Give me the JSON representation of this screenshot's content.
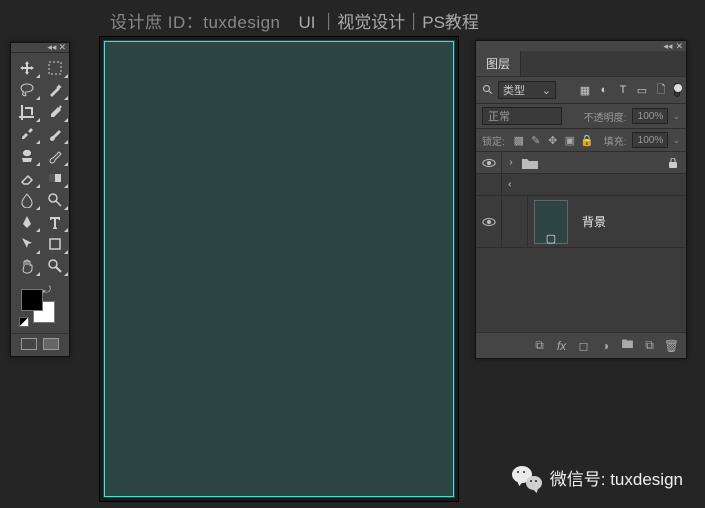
{
  "header": {
    "author_prefix": "设计庶 ID：",
    "author_id": "tuxdesign",
    "tags": "UI ｜视觉设计｜PS教程"
  },
  "tools": [
    {
      "name": "move-tool"
    },
    {
      "name": "marquee-tool"
    },
    {
      "name": "lasso-tool"
    },
    {
      "name": "magic-wand-tool"
    },
    {
      "name": "crop-tool"
    },
    {
      "name": "eyedropper-tool"
    },
    {
      "name": "healing-brush-tool"
    },
    {
      "name": "brush-tool"
    },
    {
      "name": "clone-stamp-tool"
    },
    {
      "name": "history-brush-tool"
    },
    {
      "name": "eraser-tool"
    },
    {
      "name": "gradient-tool"
    },
    {
      "name": "blur-tool"
    },
    {
      "name": "dodge-tool"
    },
    {
      "name": "pen-tool"
    },
    {
      "name": "type-tool"
    },
    {
      "name": "path-select-tool"
    },
    {
      "name": "shape-tool"
    },
    {
      "name": "hand-tool"
    },
    {
      "name": "zoom-tool"
    }
  ],
  "swatches": {
    "fg": "#000000",
    "bg": "#ffffff"
  },
  "canvas": {
    "fill": "#2d4643"
  },
  "layers_panel": {
    "tab_label": "图层",
    "filter": {
      "search_icon": "search-icon",
      "mode_label": "类型"
    },
    "blend": {
      "mode_label": "正常",
      "opacity_label": "不透明度:",
      "opacity_value": "100%"
    },
    "lock": {
      "label": "锁定:",
      "fill_label": "填充:",
      "fill_value": "100%"
    },
    "group": {
      "name": ""
    },
    "bg_layer": {
      "name": "背景"
    }
  },
  "wechat": {
    "label": "微信号: tuxdesign"
  }
}
